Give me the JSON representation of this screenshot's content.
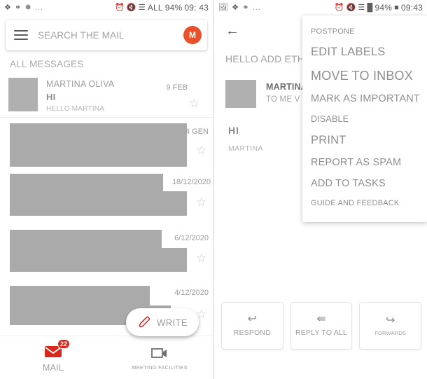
{
  "left": {
    "statusbar": {
      "icons": [
        "bluetooth-icon",
        "nfc-icon",
        "vpn-icon"
      ],
      "dots": "...",
      "right_icons": [
        "alarm-icon",
        "mute-icon",
        "wifi-icon"
      ],
      "network": "ALL",
      "battery": "94%",
      "time": "09: 43"
    },
    "search": {
      "placeholder": "SEARCH THE MAIL",
      "avatar_letter": "M"
    },
    "section_label": "ALL MESSAGES",
    "messages": [
      {
        "sender": "MARTINA OLIVA",
        "subject": "HI",
        "snippet": "HELLO MARTINA",
        "date": "9 FEB",
        "redacted": false
      },
      {
        "sender": "",
        "subject": "",
        "snippet": "",
        "date": "4 GEN",
        "redacted": true
      },
      {
        "sender": "",
        "subject": "",
        "snippet": "",
        "date": "18/12/2020",
        "redacted": true
      },
      {
        "sender": "",
        "subject": "",
        "snippet": "",
        "date": "6/12/2020",
        "redacted": true
      },
      {
        "sender": "",
        "subject": "",
        "snippet": "",
        "date": "4/12/2020",
        "redacted": true
      }
    ],
    "fab": {
      "label": "WRITE",
      "icon": "pencil-icon",
      "color": "#e0241b"
    },
    "bottom_nav": [
      {
        "label": "MAIL",
        "icon": "envelope-icon",
        "badge": "22",
        "badge_color": "#d8281c"
      },
      {
        "label": "MEETING FACILITIES",
        "icon": "video-camera-icon",
        "badge": ""
      }
    ]
  },
  "right": {
    "statusbar": {
      "icons": [
        "image-icon",
        "bluetooth-icon",
        "nfc-icon"
      ],
      "dots": "...",
      "right_icons": [
        "alarm-icon",
        "mute-icon",
        "wifi-icon",
        "signal-icon"
      ],
      "battery": "94%",
      "time": "09:43"
    },
    "back_icon": "back-arrow-icon",
    "thread_title": "HELLO ADD ETHICAL",
    "thread": {
      "sender": "MARTINA OL",
      "to": "TO ME V",
      "body_line1": "HI",
      "body_line2": "MARTINA"
    },
    "actions": [
      {
        "label": "RESPOND",
        "icon": "reply-icon"
      },
      {
        "label": "REPLY TO ALL",
        "icon": "reply-all-icon"
      },
      {
        "label": "FORWARDS",
        "icon": "forward-icon"
      }
    ]
  },
  "popup_menu": {
    "items": [
      {
        "label": "POSTPONE",
        "size": "s-xs"
      },
      {
        "label": "EDIT LABELS",
        "size": "s-lg"
      },
      {
        "label": "MOVE TO INBOX",
        "size": "s-xl"
      },
      {
        "label": "MARK AS IMPORTANT",
        "size": "s-md"
      },
      {
        "label": "DISABLE",
        "size": "s-sm"
      },
      {
        "label": "PRINT",
        "size": "s-lg"
      },
      {
        "label": "REPORT AS SPAM",
        "size": "s-md"
      },
      {
        "label": "ADD TO TASKS",
        "size": "s-md"
      },
      {
        "label": "GUIDE AND FEEDBACK",
        "size": "s-xs"
      }
    ]
  }
}
